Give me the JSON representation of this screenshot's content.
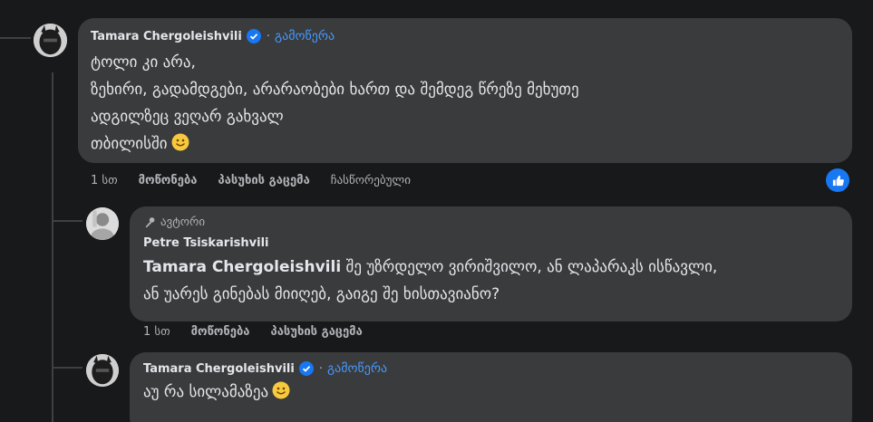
{
  "comment1": {
    "author": "Tamara Chergoleishvili",
    "follow_label": "გამოწერა",
    "lines": [
      "ტოლი კი არა,",
      "ზეხირი, გადამდგები, არარაობები ხართ და შემდეგ წრეზე მეხუთე",
      "ადგილზეც ვეღარ გახვალ",
      "თბილისში"
    ],
    "actions": {
      "time": "1 სთ",
      "like": "მოწონება",
      "reply": "პასუხის გაცემა",
      "hidden": "ჩასწორებული"
    }
  },
  "comment2": {
    "author_tag": "ავტორი",
    "author": "Petre Tsiskarishvili",
    "mention": "Tamara Chergoleishvili",
    "text_line1": " შე უზრდელო ვირიშვილო, ან ლაპარაკს ისწავლი,",
    "text_line2": "ან უარეს გინებას მიიღებ, გაიგე შე ხისთავიანო?",
    "actions": {
      "time": "1 სთ",
      "like": "მოწონება",
      "reply": "პასუხის გაცემა"
    }
  },
  "comment3": {
    "author": "Tamara Chergoleishvili",
    "follow_label": "გამოწერა",
    "text": "აუ რა სილამაზეა"
  },
  "colors": {
    "background": "#18191a",
    "bubble": "#3a3b3c",
    "accent": "#4599ff",
    "like": "#1877f2"
  }
}
